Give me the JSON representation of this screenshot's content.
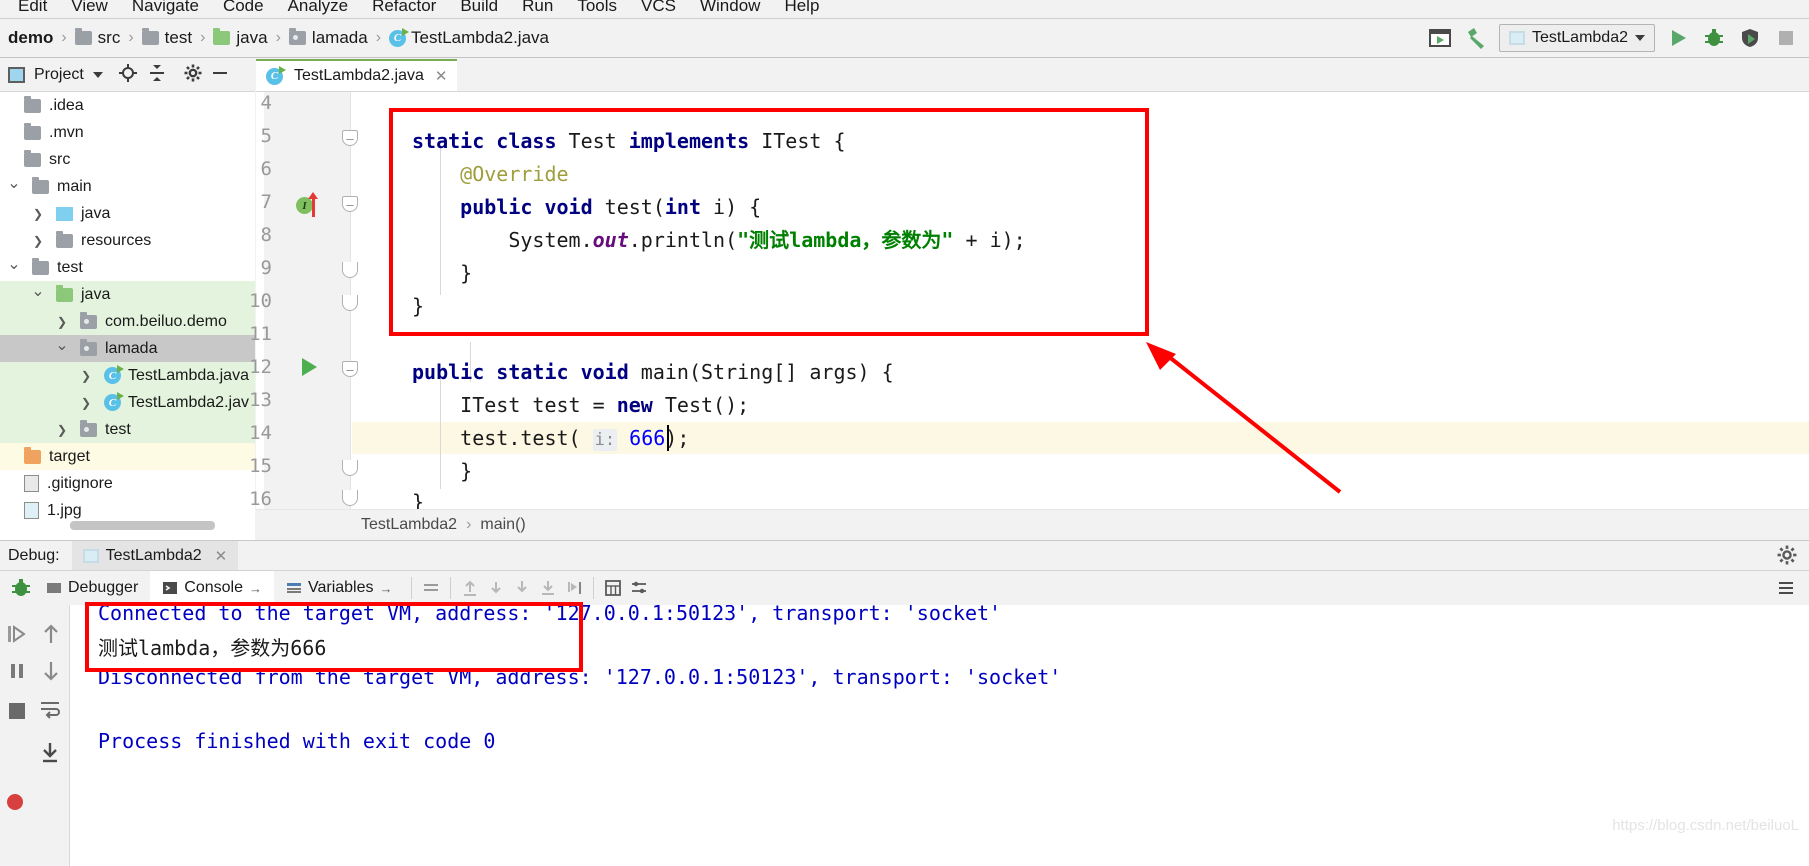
{
  "menubar": {
    "items": [
      "Edit",
      "View",
      "Navigate",
      "Code",
      "Analyze",
      "Refactor",
      "Build",
      "Run",
      "Tools",
      "VCS",
      "Window",
      "Help"
    ]
  },
  "navbar": {
    "breadcrumb": [
      {
        "label": "demo",
        "icon": "project-icon",
        "bold": true
      },
      {
        "label": "src",
        "icon": "folder-gray-icon"
      },
      {
        "label": "test",
        "icon": "folder-gray-icon"
      },
      {
        "label": "java",
        "icon": "folder-green-icon"
      },
      {
        "label": "lamada",
        "icon": "package-icon"
      },
      {
        "label": "TestLambda2.java",
        "icon": "java-class-icon"
      }
    ],
    "run_config": "TestLambda2",
    "buttons": [
      {
        "name": "select-target-icon",
        "glyph": "▶"
      },
      {
        "name": "build-hammer-icon",
        "glyph": "hammer"
      },
      {
        "name": "run-button",
        "glyph": "▶"
      },
      {
        "name": "debug-button",
        "glyph": "bug"
      },
      {
        "name": "run-with-coverage-button",
        "glyph": "coverage"
      },
      {
        "name": "stop-button",
        "glyph": "■"
      }
    ]
  },
  "project_panel": {
    "title": "Project",
    "toolbar_icons": [
      "locate-icon",
      "collapse-all-icon",
      "settings-gear-icon",
      "hide-icon"
    ],
    "tree": [
      {
        "label": ".idea",
        "indent": 0,
        "icon": "folder-gray-icon",
        "arrow": "none",
        "state": "plain"
      },
      {
        "label": ".mvn",
        "indent": 0,
        "icon": "folder-gray-icon",
        "arrow": "none",
        "state": "plain"
      },
      {
        "label": "src",
        "indent": 0,
        "icon": "folder-gray-icon",
        "arrow": "none",
        "state": "plain"
      },
      {
        "label": "main",
        "indent": 0,
        "icon": "folder-gray-icon",
        "arrow": "down",
        "state": "plain"
      },
      {
        "label": "java",
        "indent": 1,
        "icon": "folder-blue-icon",
        "arrow": "right",
        "state": "plain"
      },
      {
        "label": "resources",
        "indent": 1,
        "icon": "folder-res-icon",
        "arrow": "right",
        "state": "plain"
      },
      {
        "label": "test",
        "indent": 0,
        "icon": "folder-gray-icon",
        "arrow": "down",
        "state": "plain"
      },
      {
        "label": "java",
        "indent": 1,
        "icon": "folder-green-icon",
        "arrow": "down",
        "state": "green"
      },
      {
        "label": "com.beiluo.demo",
        "indent": 2,
        "icon": "package-icon",
        "arrow": "right",
        "state": "green"
      },
      {
        "label": "lamada",
        "indent": 2,
        "icon": "package-icon",
        "arrow": "down",
        "state": "selected"
      },
      {
        "label": "TestLambda.java",
        "indent": 3,
        "icon": "java-class-icon",
        "arrow": "right",
        "state": "green"
      },
      {
        "label": "TestLambda2.jav",
        "indent": 3,
        "icon": "java-class-icon",
        "arrow": "right",
        "state": "green"
      },
      {
        "label": "test",
        "indent": 2,
        "icon": "package-icon",
        "arrow": "right",
        "state": "green"
      },
      {
        "label": "target",
        "indent": 0,
        "icon": "folder-orange-icon",
        "arrow": "none",
        "state": "yellow"
      },
      {
        "label": ".gitignore",
        "indent": 0,
        "icon": "file-icon",
        "arrow": "none",
        "state": "plain"
      },
      {
        "label": "1.jpg",
        "indent": 0,
        "icon": "image-file-icon",
        "arrow": "none",
        "state": "plain"
      }
    ]
  },
  "editor": {
    "tab": "TestLambda2.java",
    "tab_icon": "java-class-icon",
    "line_numbers": [
      "4",
      "5",
      "6",
      "7",
      "8",
      "9",
      "10",
      "11",
      "12",
      "13",
      "14",
      "15",
      "16"
    ],
    "lines": [
      "",
      "static class Test implements ITest {",
      "    @Override",
      "    public void test(int i) {",
      "        System.out.println(\"测试lambda，参数为\" + i);",
      "    }",
      "}",
      "",
      "public static void main(String[] args) {",
      "    ITest test = new Test();",
      "    test.test( i: 666);",
      "}",
      "}"
    ],
    "param_hint": "i:",
    "param_value": "666",
    "gutter_marker_line": "7",
    "gutter_marker_label": "I",
    "run_marker_line": "12",
    "breadcrumb_bottom": [
      "TestLambda2",
      "main()"
    ]
  },
  "debug_panel": {
    "title": "Debug:",
    "session_tab": "TestLambda2",
    "tabs": [
      {
        "label": "Debugger",
        "icon": "debugger-icon",
        "active": false
      },
      {
        "label": "Console",
        "icon": "console-icon",
        "active": true
      },
      {
        "label": "Variables",
        "icon": "variables-icon",
        "active": false
      }
    ],
    "left_buttons": [
      "resume-icon",
      "step-over-icon",
      "pause-icon",
      "stop-icon",
      "mute-breakpoints-icon",
      "settings-icon"
    ],
    "console_lines": [
      {
        "text": "Connected to the target VM, address: '127.0.0.1:50123', transport: 'socket'",
        "style": "system"
      },
      {
        "text": "测试lambda，参数为666",
        "style": "output"
      },
      {
        "text": "Disconnected from the target VM, address: '127.0.0.1:50123', transport: 'socket'",
        "style": "system"
      },
      {
        "text": "",
        "style": "output"
      },
      {
        "text": "Process finished with exit code 0",
        "style": "system"
      }
    ]
  },
  "watermark": "https://blog.csdn.net/beiluoL",
  "colors": {
    "accent_green": "#59a869",
    "annotation_red": "#ff0000",
    "keyword_blue": "#000080",
    "string_green": "#008000",
    "annotation_yellow": "#9e9e3c",
    "field_purple": "#660e7a",
    "selection_gray": "#c8c8c8",
    "tree_green": "#e4f3dd"
  }
}
